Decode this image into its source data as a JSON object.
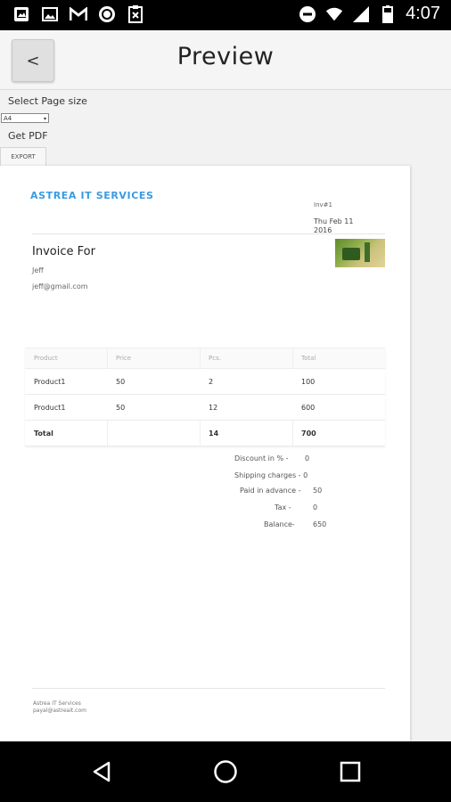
{
  "status_bar": {
    "time": "4:07",
    "left_icons": [
      "gallery-icon",
      "image-icon",
      "gmail-icon",
      "app-icon",
      "clipboard-icon"
    ],
    "right_icons": [
      "dnd-icon",
      "wifi-icon",
      "signal-icon",
      "battery-icon"
    ]
  },
  "topbar": {
    "back_label": "<",
    "title": "Preview"
  },
  "controls": {
    "select_page_size_label": "Select Page size",
    "page_size_value": "A4",
    "get_pdf_label": "Get PDF",
    "export_label": "EXPORT"
  },
  "invoice": {
    "company": "ASTREA IT SERVICES",
    "invoice_number": "Inv#1",
    "date": "Thu Feb 11 2016",
    "invoice_for_label": "Invoice For",
    "client_name": "Jeff",
    "client_email": "jeff@gmail.com",
    "table": {
      "headers": [
        "Product",
        "Price",
        "Pcs.",
        "Total"
      ],
      "rows": [
        [
          "Product1",
          "50",
          "2",
          "100"
        ],
        [
          "Product1",
          "50",
          "12",
          "600"
        ]
      ],
      "footer": [
        "Total",
        "",
        "14",
        "700"
      ]
    },
    "summary": {
      "discount_label": "Discount in % -",
      "discount_value": "0",
      "shipping_label": "Shipping charges - 0",
      "paid_label": "Paid in advance -",
      "paid_value": "50",
      "tax_label": "Tax -",
      "tax_value": "0",
      "balance_label": "Balance-",
      "balance_value": "650"
    },
    "footer_company": "Astrea IT Services",
    "footer_email": "payal@astreait.com"
  },
  "colors": {
    "brand_blue": "#3a9be0",
    "status_bar": "#000000",
    "nav_bar": "#000000"
  }
}
